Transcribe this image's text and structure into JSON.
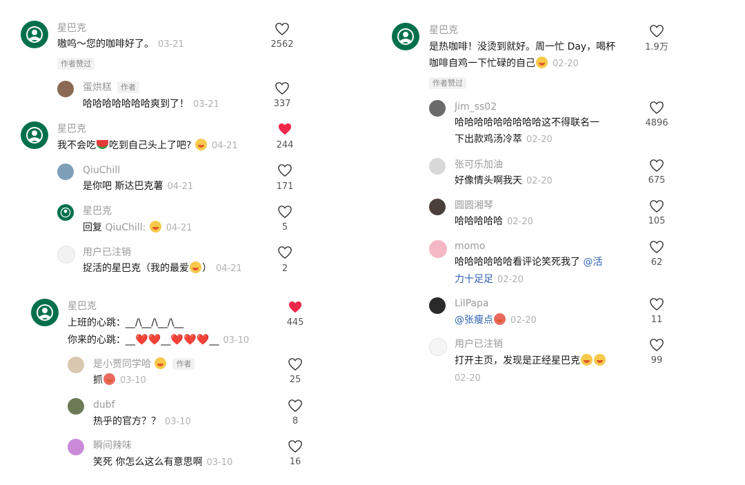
{
  "colors": {
    "brand": "#00704a",
    "liked": "#f02849",
    "name": "#9a9a9a",
    "mention": "#2e5fb2"
  },
  "left": {
    "c1": {
      "name": "星巴克",
      "text": "嗷呜～您的咖啡好了。",
      "time": "03-21",
      "likes": "2562",
      "author_liked": "作者赞过",
      "reply": {
        "name": "蛋烘糕",
        "tag": "作者",
        "text": "哈哈哈哈哈哈哈爽到了！",
        "time": "03-21",
        "likes": "337"
      }
    },
    "c2": {
      "name": "星巴克",
      "text_a": "我不会吃",
      "text_b": "吃到自己头上了吧?",
      "time": "04-21",
      "likes": "244",
      "replies": [
        {
          "name": "QiuChill",
          "text": "是你吧 斯达巴克薯",
          "time": "04-21",
          "likes": "171"
        },
        {
          "name": "星巴克",
          "text": "回复 ",
          "mention": "QiuChill:",
          "time": "04-21",
          "likes": "5"
        },
        {
          "name": "用户已注销",
          "text_a": "捉活的星巴克（我的最爱",
          "text_b": "）",
          "time": "04-21",
          "likes": "2"
        }
      ]
    },
    "c3": {
      "name": "星巴克",
      "line1": "上班的心跳：__/\\__/\\__/\\__",
      "line2_a": "你来的心跳：__",
      "line2_b": "__",
      "line2_c": "__",
      "time": "03-10",
      "likes": "445",
      "replies": [
        {
          "name": "是小贾同学哈",
          "tag": "作者",
          "text": "抓",
          "time": "03-10",
          "likes": "25"
        },
        {
          "name": "dubf",
          "text": "热乎的官方？？",
          "time": "03-10",
          "likes": "8"
        },
        {
          "name": "瞬间辣味",
          "text": "笑死 你怎么这么有意思啊",
          "time": "03-10",
          "likes": "16"
        }
      ]
    }
  },
  "right": {
    "main": {
      "name": "星巴克",
      "line1": "是热咖啡！没烫到就好。周一忙 Day，喝杯",
      "line2": "咖啡自鸡一下忙碌的自己",
      "time": "02-20",
      "likes": "1.9万",
      "author_liked": "作者赞过"
    },
    "replies": [
      {
        "name": "Jim_ss02",
        "line1": "哈哈哈哈哈哈哈哈哈这不得联名一",
        "line2": "下出款鸡汤冷萃",
        "time": "02-20",
        "likes": "4896"
      },
      {
        "name": "张可乐加油",
        "text": "好像情头啊我天",
        "time": "02-20",
        "likes": "675"
      },
      {
        "name": "圆圆湘琴",
        "text": "哈哈哈哈哈",
        "time": "02-20",
        "likes": "105"
      },
      {
        "name": "momo",
        "line1": "哈哈哈哈哈哈看评论笑死我了",
        "mention1": "@活",
        "line2_mention": "力十足足",
        "time": "02-20",
        "likes": "62"
      },
      {
        "name": "LilPapa",
        "mention": "@张瘦点",
        "time": "02-20",
        "likes": "11"
      },
      {
        "name": "用户已注销",
        "text": "打开主页，发现是正经星巴克",
        "time": "02-20",
        "likes": "99"
      }
    ]
  }
}
